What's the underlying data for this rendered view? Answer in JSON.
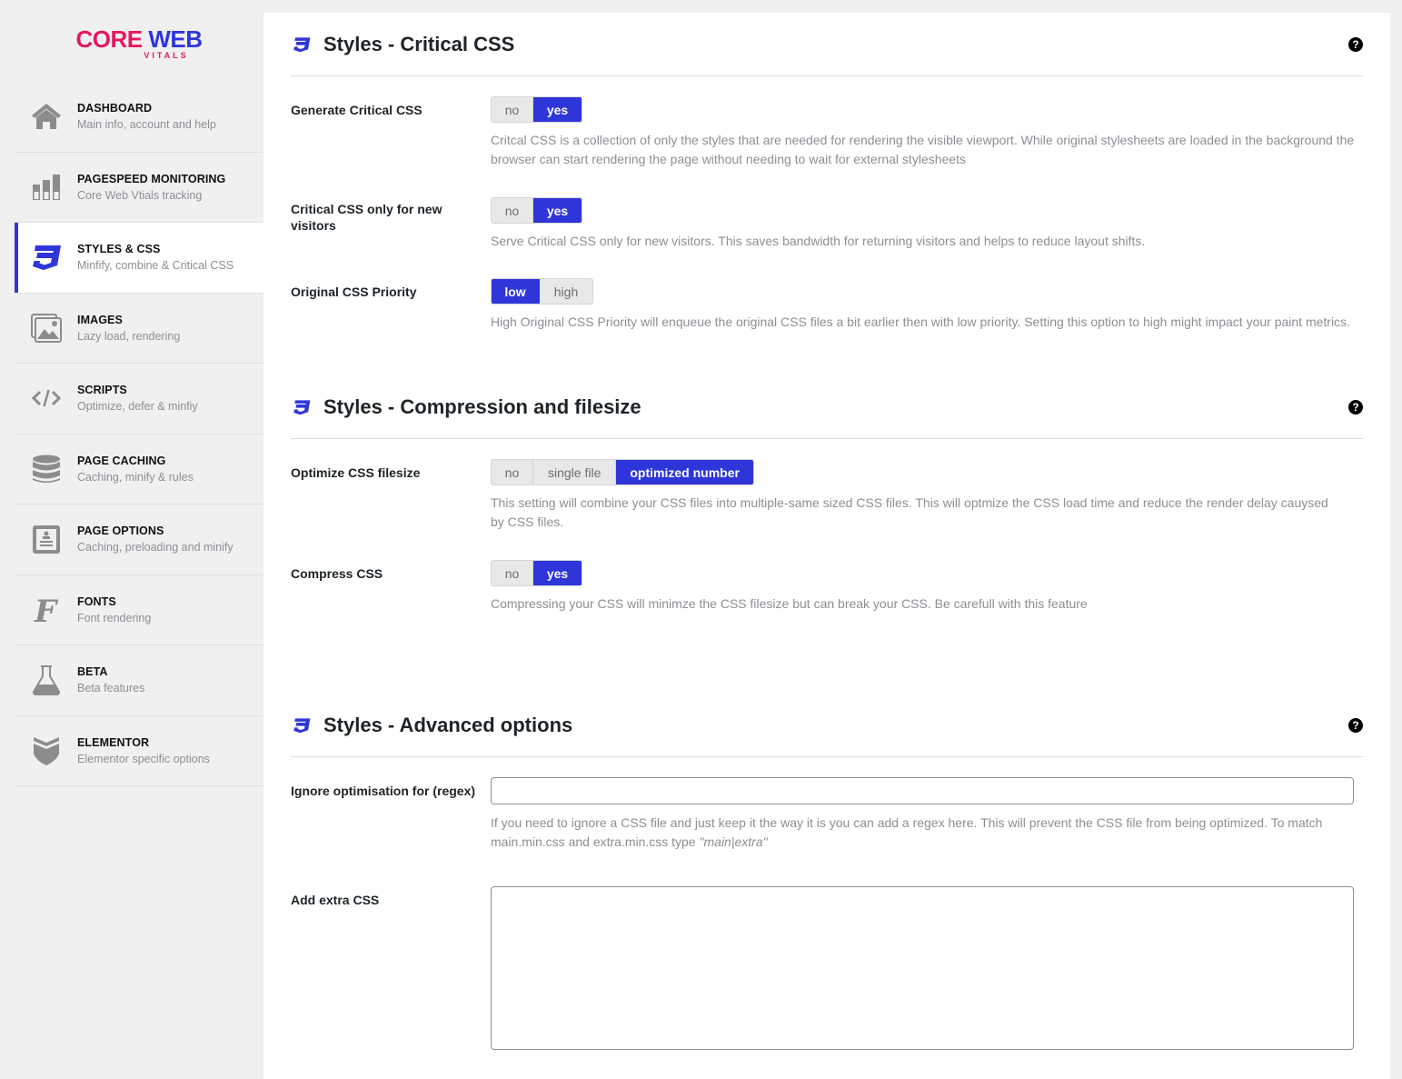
{
  "logo": {
    "part1": "CORE",
    "part2": "WEB",
    "sub": "VITALS"
  },
  "colors": {
    "accent": "#2f36d9",
    "brand_pink": "#e6195e",
    "icon_gray": "#8c8c8c"
  },
  "sidebar": {
    "items": [
      {
        "title": "DASHBOARD",
        "subtitle": "Main info, account and help",
        "icon": "home-icon"
      },
      {
        "title": "PAGESPEED MONITORING",
        "subtitle": "Core Web Vtials tracking",
        "icon": "bar-chart-icon"
      },
      {
        "title": "STYLES & CSS",
        "subtitle": "Minfify, combine & Critical CSS",
        "icon": "css3-icon",
        "active": true
      },
      {
        "title": "IMAGES",
        "subtitle": "Lazy load, rendering",
        "icon": "images-icon"
      },
      {
        "title": "SCRIPTS",
        "subtitle": "Optimize, defer & minfiy",
        "icon": "code-icon"
      },
      {
        "title": "PAGE CACHING",
        "subtitle": "Caching, minify & rules",
        "icon": "database-icon"
      },
      {
        "title": "PAGE OPTIONS",
        "subtitle": "Caching, preloading and minify",
        "icon": "page-options-icon"
      },
      {
        "title": "FONTS",
        "subtitle": "Font rendering",
        "icon": "font-icon"
      },
      {
        "title": "BETA",
        "subtitle": "Beta features",
        "icon": "flask-icon"
      },
      {
        "title": "ELEMENTOR",
        "subtitle": "Elementor specific options",
        "icon": "elementor-icon"
      }
    ]
  },
  "sections": {
    "critical": {
      "title": "Styles - Critical CSS",
      "help": "?",
      "generate": {
        "label": "Generate Critical CSS",
        "options": [
          "no",
          "yes"
        ],
        "selected": "yes",
        "desc": "Critcal CSS is a collection of only the styles that are needed for rendering the visible viewport. While original stylesheets are loaded in the background the browser can start rendering the page without needing to wait for external stylesheets"
      },
      "new_visitors": {
        "label": "Critical CSS only for new visitors",
        "options": [
          "no",
          "yes"
        ],
        "selected": "yes",
        "desc": "Serve Critical CSS only for new visitors. This saves bandwidth for returning visitors and helps to reduce layout shifts."
      },
      "priority": {
        "label": "Original CSS Priority",
        "options": [
          "low",
          "high"
        ],
        "selected": "low",
        "desc": "High Original CSS Priority will enqueue the original CSS files a bit earlier then with low priority. Setting this option to high might impact your paint metrics."
      }
    },
    "compression": {
      "title": "Styles - Compression and filesize",
      "help": "?",
      "optimize": {
        "label": "Optimize CSS filesize",
        "options": [
          "no",
          "single file",
          "optimized number"
        ],
        "selected": "optimized number",
        "desc": "This setting will combine your CSS files into multiple-same sized CSS files. This will optmize the CSS load time and reduce the render delay cauysed by CSS files."
      },
      "compress": {
        "label": "Compress CSS",
        "options": [
          "no",
          "yes"
        ],
        "selected": "yes",
        "desc": "Compressing your CSS will minimze the CSS filesize but can break your CSS. Be carefull with this feature"
      }
    },
    "advanced": {
      "title": "Styles - Advanced options",
      "help": "?",
      "ignore": {
        "label": "Ignore optimisation for (regex)",
        "value": "",
        "desc_pre": "If you need to ignore a CSS file and just keep it the way it is you can add a regex here. This will prevent the CSS file from being optimized. To match main.min.css and extra.min.css type ",
        "desc_example": "\"main|extra\""
      },
      "extra": {
        "label": "Add extra CSS",
        "value": ""
      }
    }
  }
}
